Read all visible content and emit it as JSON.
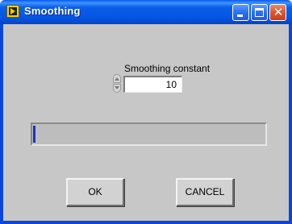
{
  "window": {
    "title": "Smoothing",
    "app_icon": "labview-run-icon",
    "controls": {
      "minimize_icon": "minimize-icon",
      "maximize_icon": "maximize-icon",
      "close_icon": "close-icon",
      "close_glyph": "✕"
    }
  },
  "smoothing": {
    "label": "Smoothing constant",
    "value": "10"
  },
  "progress": {
    "fraction": 0.01
  },
  "buttons": {
    "ok_label": "OK",
    "cancel_label": "CANCEL"
  },
  "colors": {
    "titlebar": "#0556e4",
    "panel": "#c7c7c7",
    "progress_fill": "#1a2fd0"
  }
}
